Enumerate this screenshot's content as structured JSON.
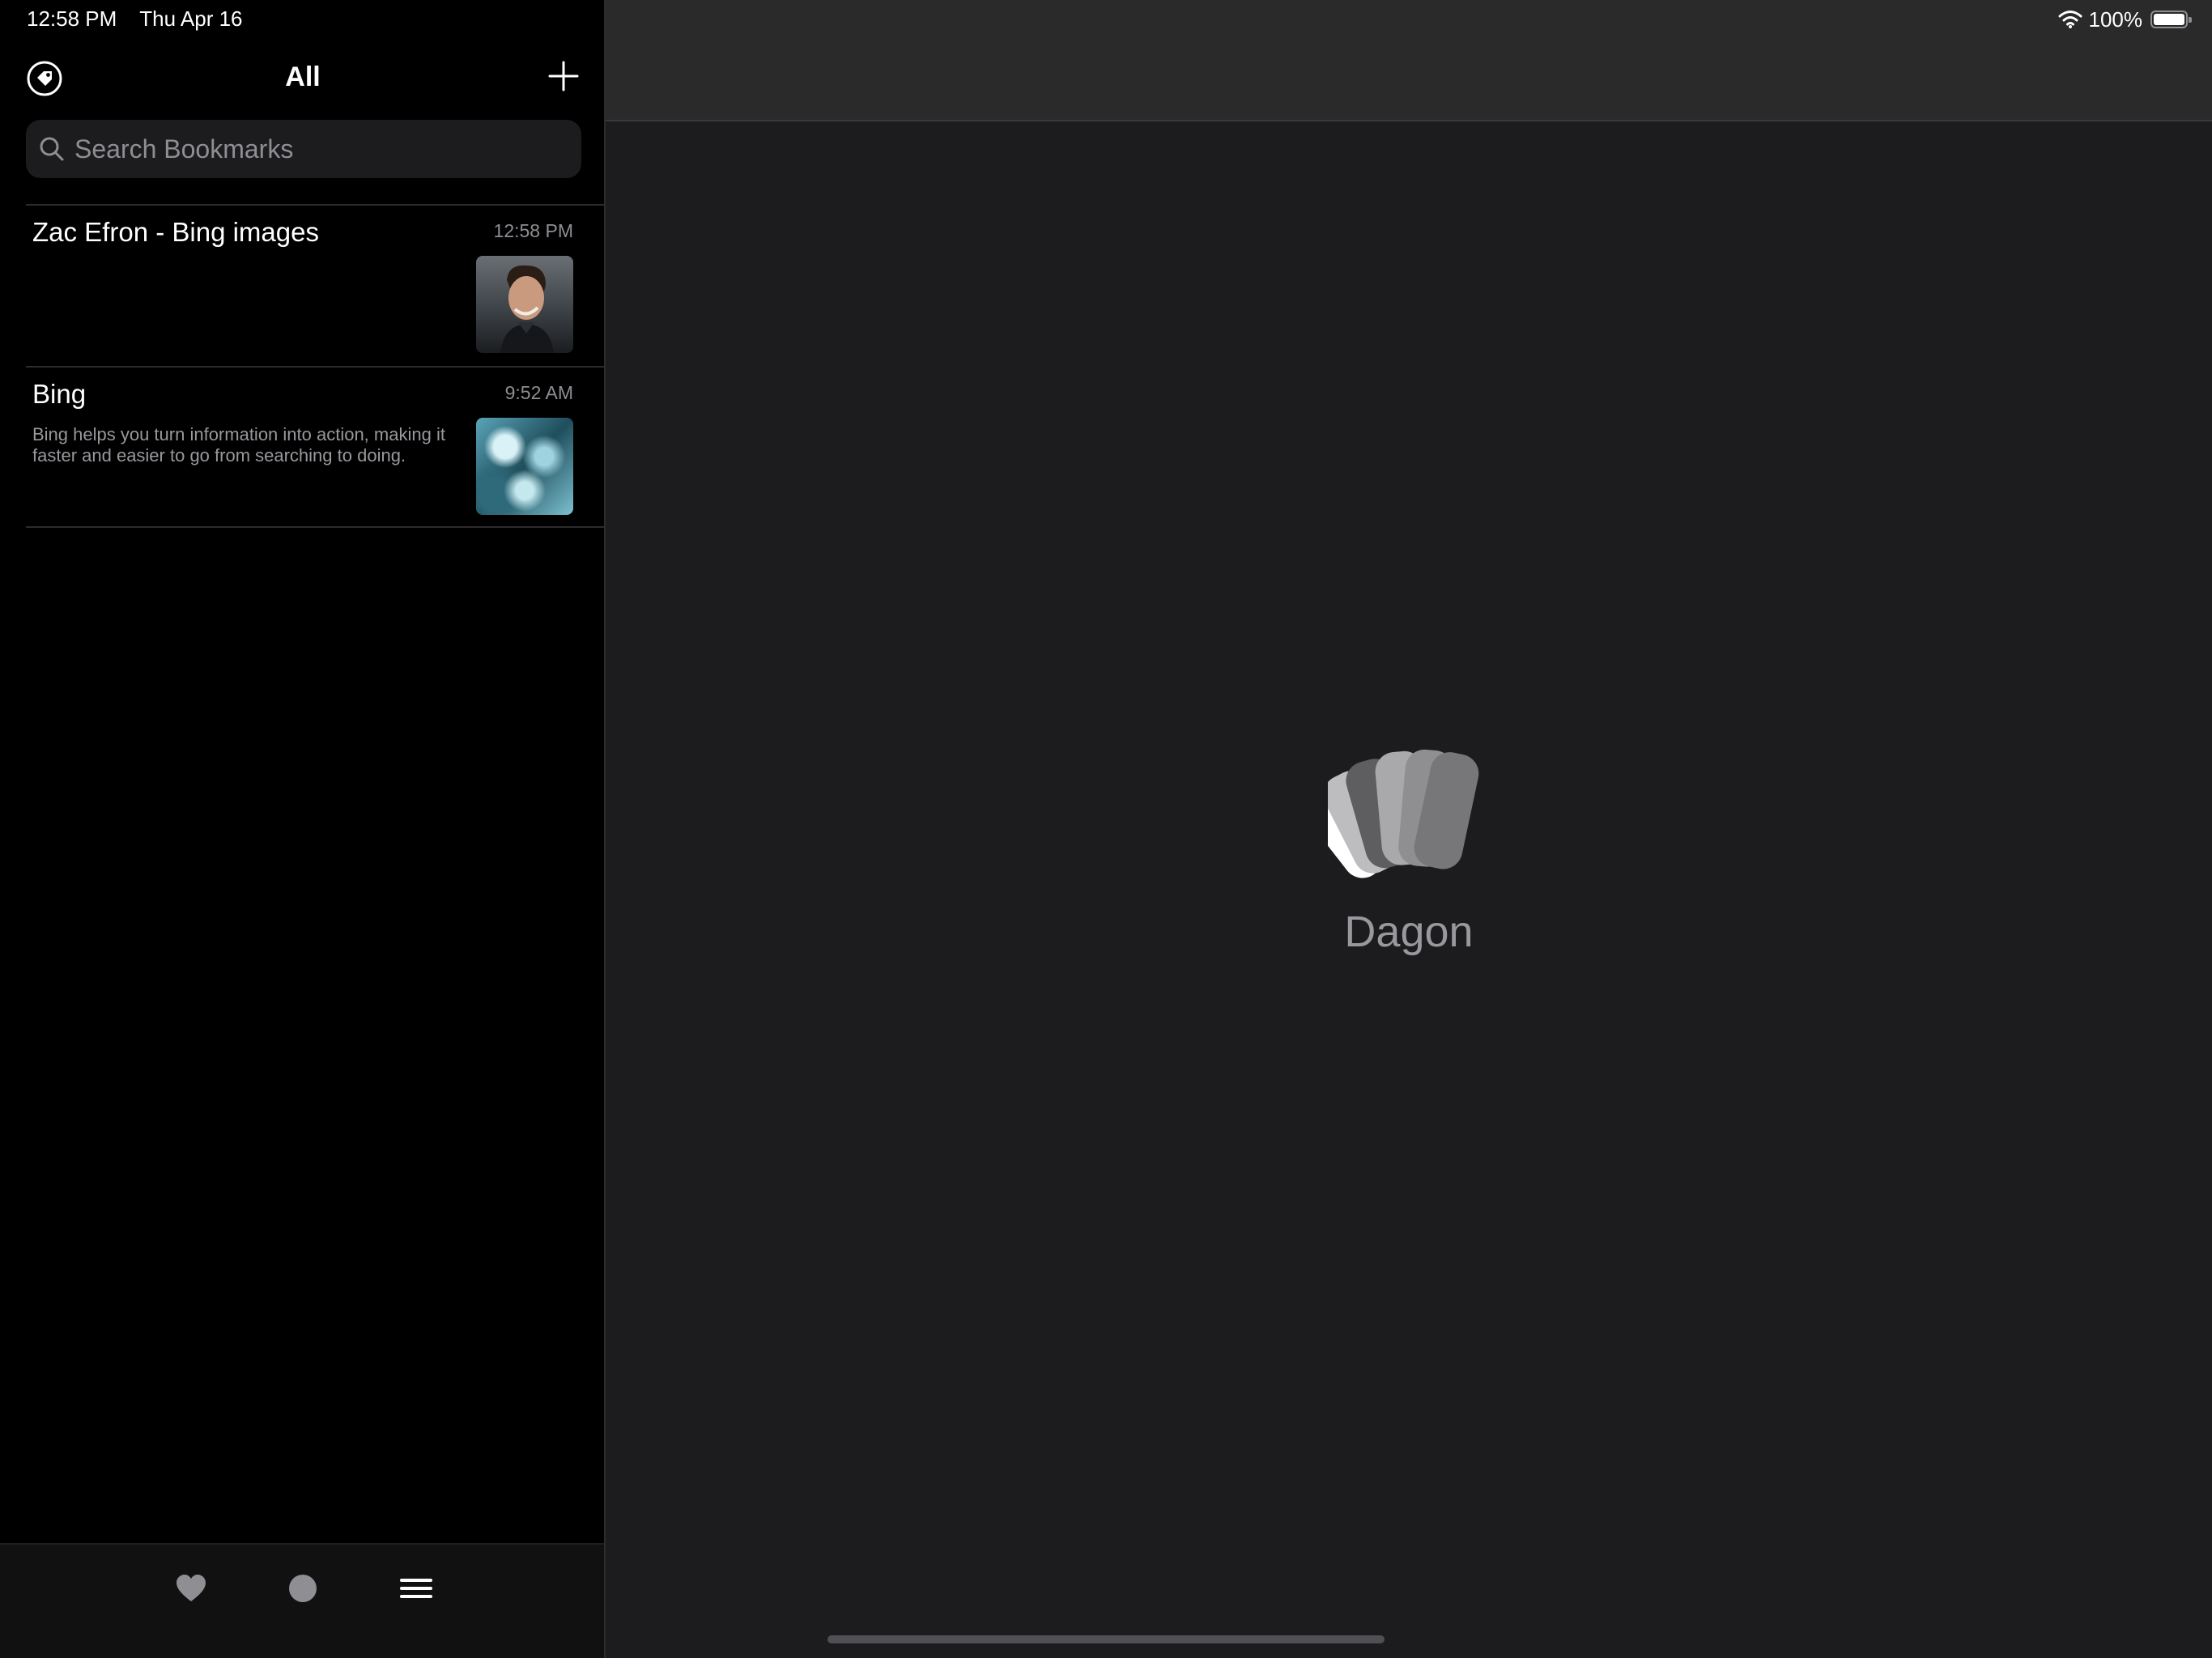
{
  "status_bar": {
    "time": "12:58 PM",
    "date": "Thu Apr 16",
    "battery": "100%"
  },
  "sidebar": {
    "title": "All",
    "search": {
      "placeholder": "Search Bookmarks",
      "value": ""
    },
    "bookmarks": [
      {
        "title": "Zac Efron - Bing images",
        "time": "12:58 PM",
        "description": "",
        "thumbnail": "portrait-photo"
      },
      {
        "title": "Bing",
        "time": "9:52 AM",
        "description": "Bing helps you turn information into action, making it faster and easier to go from searching to doing.",
        "thumbnail": "abstract-blue-image"
      }
    ],
    "tab_bar": {
      "icons": [
        "heart-icon",
        "circle-icon",
        "menu-icon"
      ]
    }
  },
  "detail": {
    "app_name": "Dagon",
    "logo": "dagon-logo"
  },
  "colors": {
    "sidebar_bg": "#000000",
    "detail_bg": "#1c1c1e",
    "toolbar_bg": "#2a2a2b",
    "secondary_text": "#8e8e93"
  }
}
